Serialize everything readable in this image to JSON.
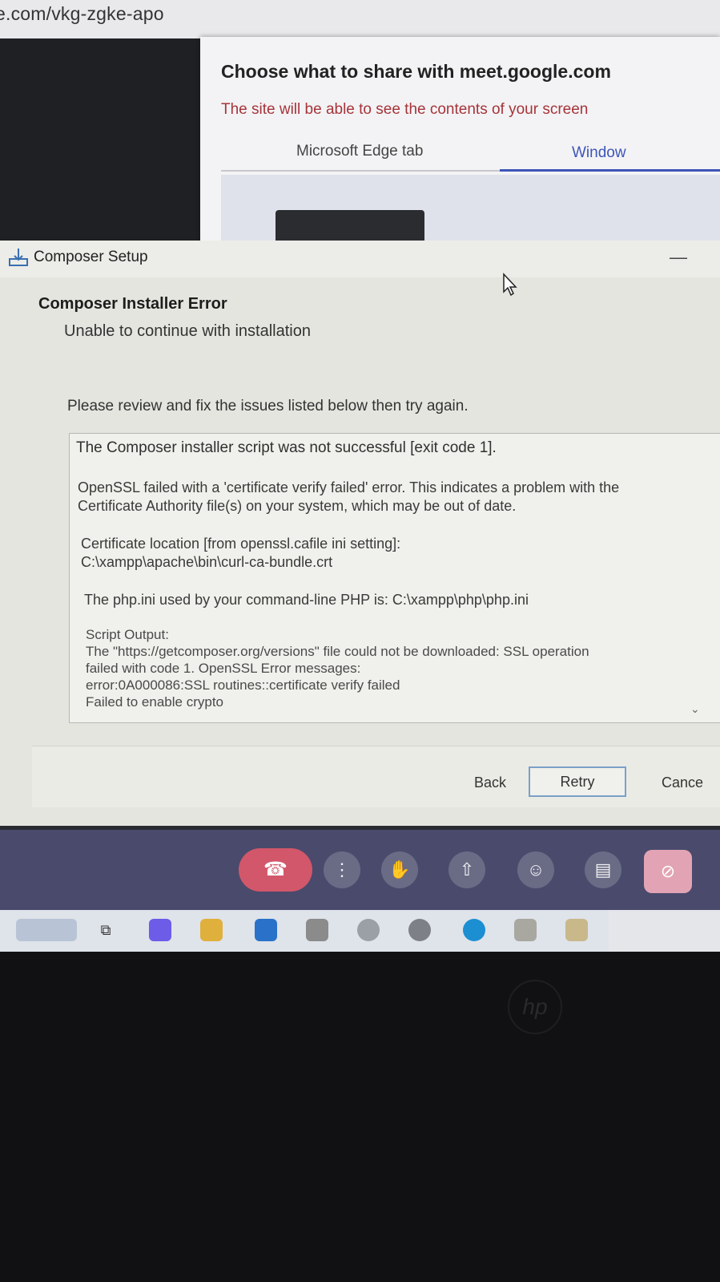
{
  "browser": {
    "url": "e.com/vkg-zgke-apo"
  },
  "share_dialog": {
    "title": "Choose what to share with meet.google.com",
    "subtitle": "The site will be able to see the contents of your screen",
    "tabs": [
      {
        "label": "Microsoft Edge tab",
        "selected": false
      },
      {
        "label": "Window",
        "selected": true
      }
    ]
  },
  "composer": {
    "window_title": "Composer Setup",
    "heading": "Composer Installer Error",
    "subheading": "Unable to continue with installation",
    "instruction": "Please review and fix the issues listed below then try again.",
    "messages": [
      "The Composer installer script was not successful [exit code 1].",
      "OpenSSL failed with a 'certificate verify failed' error. This indicates a problem with the\nCertificate Authority file(s) on your system, which may be out of date.",
      "Certificate location [from openssl.cafile ini setting]:\nC:\\xampp\\apache\\bin\\curl-ca-bundle.crt",
      "The php.ini used by your command-line PHP is: C:\\xampp\\php\\php.ini",
      "Script Output:\nThe \"https://getcomposer.org/versions\" file could not be downloaded: SSL operation\nfailed with code 1. OpenSSL Error messages:\nerror:0A000086:SSL routines::certificate verify failed\nFailed to enable crypto"
    ],
    "buttons": {
      "back": "Back",
      "retry": "Retry",
      "cancel": "Cance"
    }
  },
  "meet_toolbar": {
    "icons": [
      "hang-up-icon",
      "more-options-icon",
      "raise-hand-icon",
      "present-icon",
      "emoji-icon",
      "captions-icon",
      "camera-off-icon"
    ],
    "hangup_color": "#d2576a"
  },
  "taskbar": {
    "icons": [
      "weather-icon",
      "task-view-icon",
      "copilot-icon",
      "file-explorer-icon",
      "outlook-icon",
      "store-icon",
      "chrome-icon",
      "app-icon",
      "edge-icon",
      "app-icon-2",
      "app-icon-3"
    ]
  },
  "brand": {
    "laptop_logo": "hp"
  }
}
